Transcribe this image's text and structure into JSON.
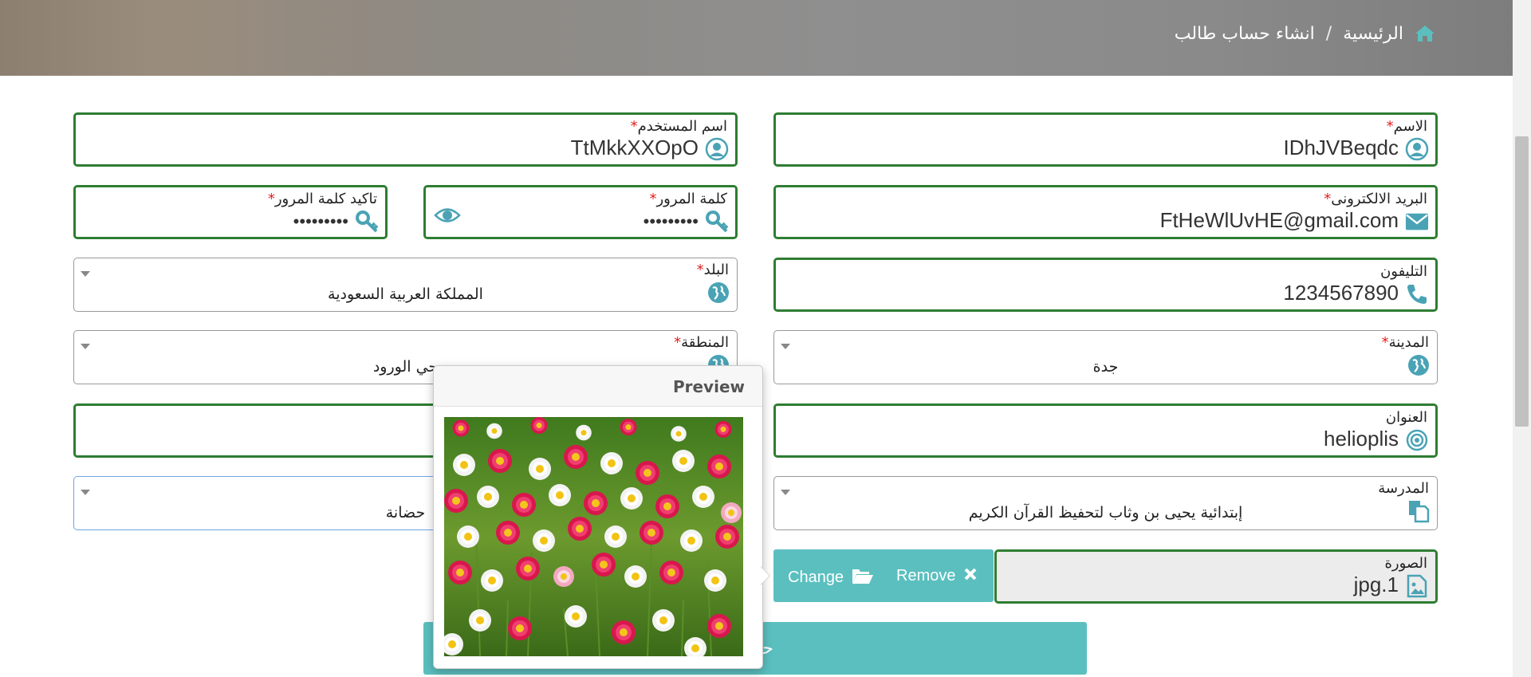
{
  "breadcrumb": {
    "home": "الرئيسية",
    "separator": "/",
    "current": "انشاء حساب طالب"
  },
  "fields": {
    "name": {
      "label": "الاسم",
      "required": "*",
      "value": "IDhJVBeqdc"
    },
    "username": {
      "label": "اسم المستخدم",
      "required": "*",
      "value": "TtMkkXXOpO"
    },
    "email": {
      "label": "البريد الالكترونى",
      "required": "*",
      "value": "FtHeWlUvHE@gmail.com"
    },
    "password": {
      "label": "كلمة المرور",
      "required": "*",
      "value": "•••••••••"
    },
    "confirm_password": {
      "label": "تاكيد كلمة المرور",
      "required": "*",
      "value": "•••••••••"
    },
    "phone": {
      "label": "التليفون",
      "value": "1234567890"
    },
    "country": {
      "label": "البلد",
      "required": "*",
      "value": "المملكة العربية السعودية"
    },
    "city": {
      "label": "المدينة",
      "required": "*",
      "value": "جدة"
    },
    "district": {
      "label": "المنطقة",
      "required": "*",
      "value": "حي الورود"
    },
    "address": {
      "label": "العنوان",
      "value": "helioplis"
    },
    "school": {
      "label": "المدرسة",
      "value": "إبتدائية يحيى بن وثاب لتحفيظ القرآن الكريم"
    },
    "stage": {
      "value": "حضانة"
    },
    "photo": {
      "label": "الصورة",
      "value": "jpg.1"
    }
  },
  "buttons": {
    "change": "Change",
    "remove": "Remove",
    "submit": "حفظ"
  },
  "popover": {
    "title": "Preview"
  },
  "colors": {
    "field_border": "#2e7d32",
    "accent": "#5bbfbf",
    "icon": "#4aa3b5",
    "required": "#e41e1e"
  }
}
